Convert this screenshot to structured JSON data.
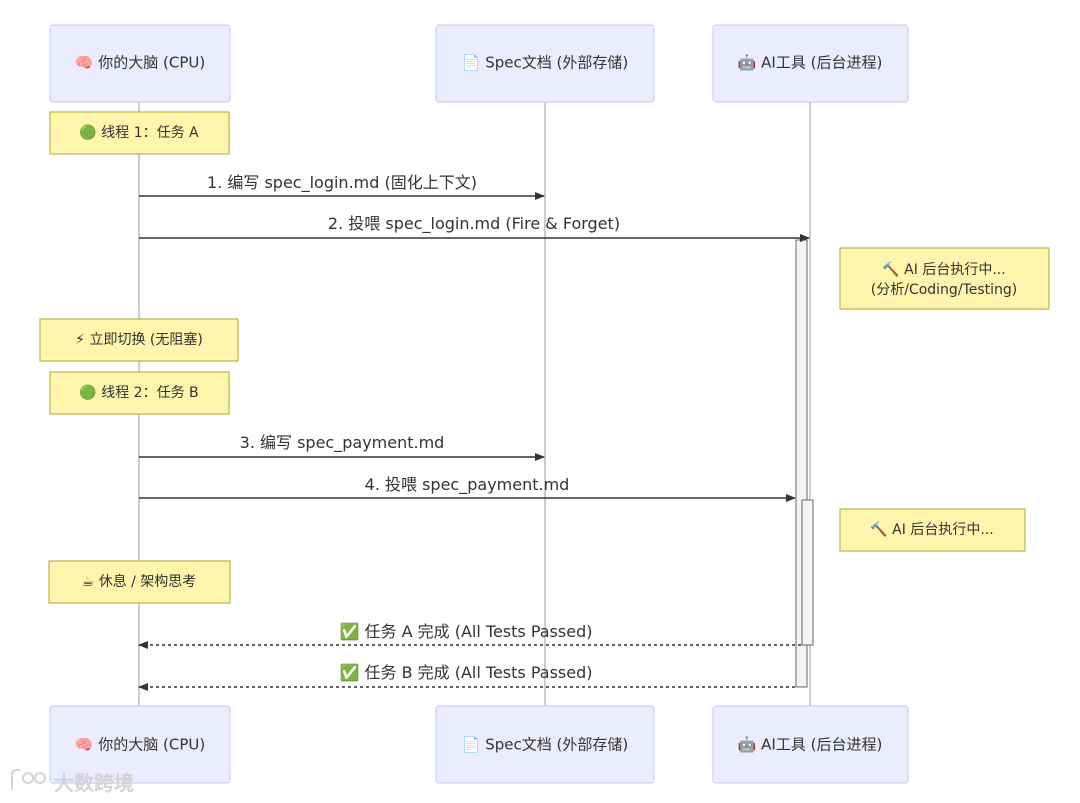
{
  "participants": {
    "brain": "🧠 你的大脑 (CPU)",
    "spec": "📄 Spec文档 (外部存储)",
    "ai": "🤖 AI工具 (后台进程)"
  },
  "notes": {
    "thread1": "🟢 线程 1：任务 A",
    "ai_run1_line1": "🔨 AI 后台执行中...",
    "ai_run1_line2": "(分析/Coding/Testing)",
    "switch": "⚡ 立即切换 (无阻塞)",
    "thread2": "🟢 线程 2：任务 B",
    "ai_run2": "🔨 AI 后台执行中...",
    "rest": "☕ 休息 / 架构思考"
  },
  "messages": {
    "m1": "1. 编写 spec_login.md (固化上下文)",
    "m2": "2. 投喂 spec_login.md (Fire & Forget)",
    "m3": "3. 编写 spec_payment.md",
    "m4": "4. 投喂 spec_payment.md",
    "r1": "✅ 任务 A 完成 (All Tests Passed)",
    "r2": "✅ 任务 B 完成 (All Tests Passed)"
  },
  "watermark": "大数跨境",
  "colors": {
    "actor_fill": "#ECECFF",
    "note_fill": "#FFF5AD",
    "line": "#333333"
  }
}
